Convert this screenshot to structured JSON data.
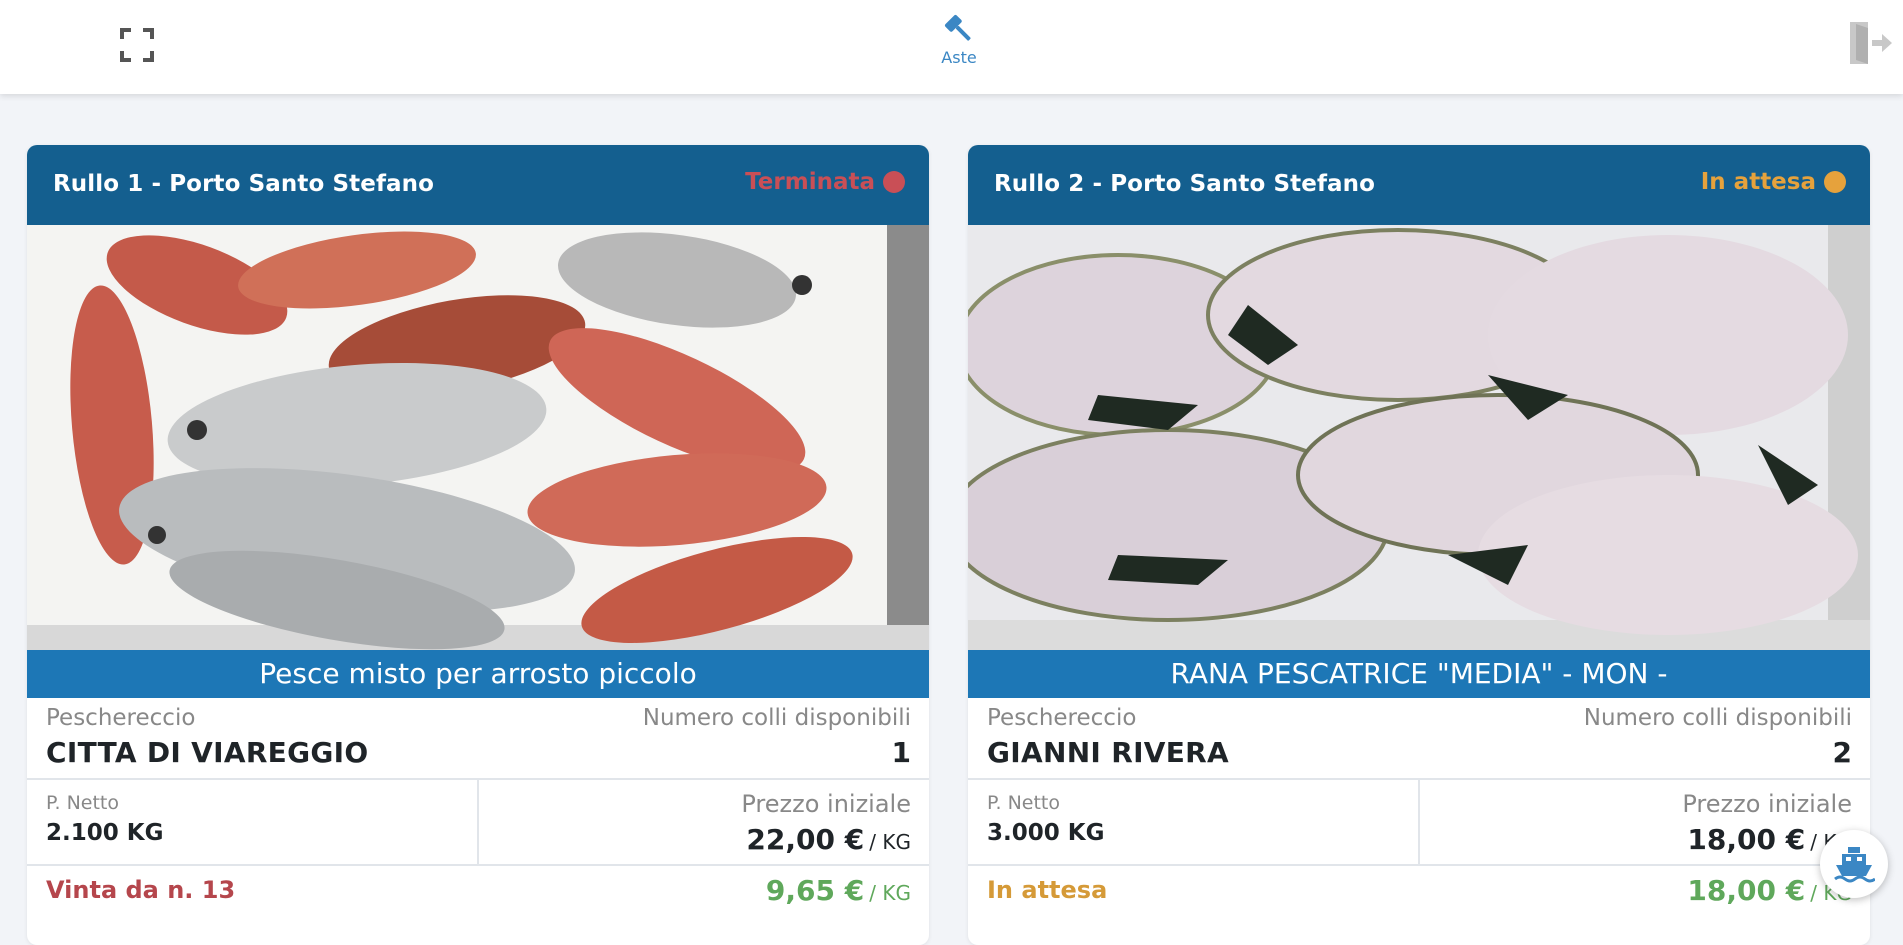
{
  "topbar": {
    "fullscreen_icon": "fullscreen-icon",
    "nav_tab_label": "Aste",
    "nav_tab_icon": "gavel-icon",
    "logout_icon": "logout-icon"
  },
  "colors": {
    "header_bg": "#145f8f",
    "product_bar": "#1d77b6",
    "terminated": "#c94f56",
    "waiting": "#e6a23c",
    "sold_text": "#b5464c",
    "waiting_text": "#d59a38",
    "price_green": "#5fa85b"
  },
  "cards": [
    {
      "title": "Rullo 1 - Porto Santo Stefano",
      "status": "Terminata",
      "status_color": "#c94f56",
      "product": "Pesce misto per arrosto piccolo",
      "boat_label": "Peschereccio",
      "boat": "CITTA DI VIAREGGIO",
      "packages_label": "Numero colli disponibili",
      "packages": "1",
      "weight_label": "P. Netto",
      "weight": "2.100 KG",
      "start_price_label": "Prezzo iniziale",
      "start_price": "22,00 €",
      "start_unit": "/ KG",
      "result": "Vinta da n. 13",
      "current_price": "9,65 €",
      "current_unit": "/ KG"
    },
    {
      "title": "Rullo 2 - Porto Santo Stefano",
      "status": "In attesa",
      "status_color": "#e6a23c",
      "product": "RANA PESCATRICE \"MEDIA\" - MON -",
      "boat_label": "Peschereccio",
      "boat": "GIANNI RIVERA",
      "packages_label": "Numero colli disponibili",
      "packages": "2",
      "weight_label": "P. Netto",
      "weight": "3.000 KG",
      "start_price_label": "Prezzo iniziale",
      "start_price": "18,00 €",
      "start_unit": "/ KG",
      "result": "In attesa",
      "current_price": "18,00 €",
      "current_unit": "/ KG"
    }
  ],
  "floating_button_icon": "ship-icon"
}
